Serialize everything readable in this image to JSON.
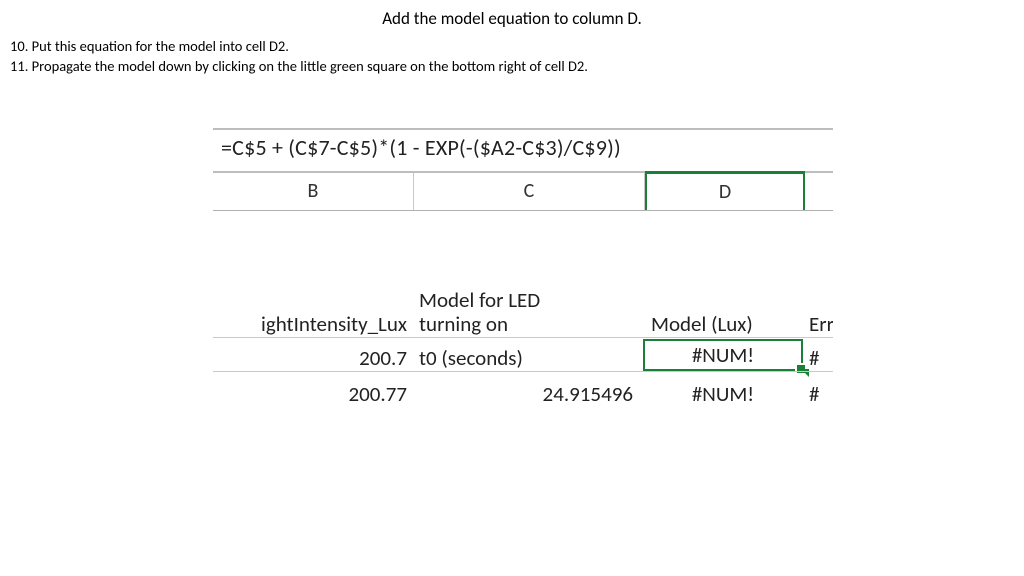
{
  "title": "Add the model equation to column D.",
  "steps": {
    "s10": "10. Put this equation for the model into cell D2.",
    "s11": "11. Propagate the model down by clicking on the little green square on the bottom right of cell D2."
  },
  "formula": "=C$5 + (C$7-C$5)*(1 - EXP(-($A2-C$3)/C$9))",
  "cols": {
    "b": "B",
    "c": "C",
    "d": "D"
  },
  "row1": {
    "b": "ightIntensity_Lux",
    "c_upper": "Model for LED",
    "c_lower": "turning on",
    "d": "Model (Lux)",
    "e": "Err"
  },
  "row2": {
    "b": "200.7",
    "c": "t0 (seconds)",
    "d": "#NUM!",
    "e": "#"
  },
  "row3": {
    "b": "200.77",
    "c": "24.915496",
    "d": "#NUM!",
    "e": "#"
  }
}
